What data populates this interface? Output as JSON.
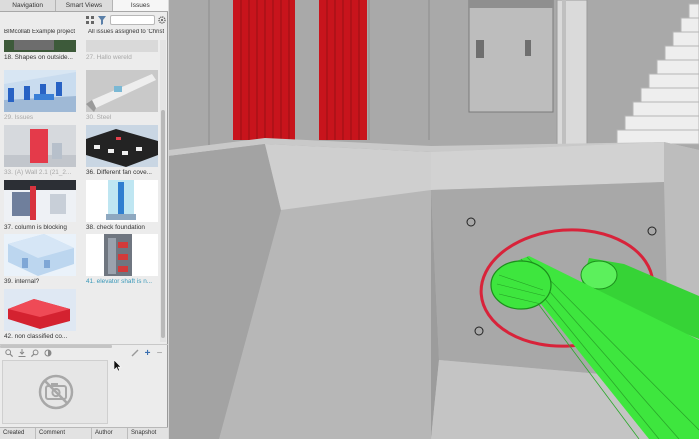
{
  "tabs": [
    {
      "label": "Navigation",
      "active": false
    },
    {
      "label": "Smart Views",
      "active": false
    },
    {
      "label": "Issues",
      "active": true
    }
  ],
  "filter": {
    "search_value": ""
  },
  "project": {
    "left": "BIMcollab Example project",
    "right": "All issues assigned to 'Christi..."
  },
  "issues": [
    {
      "label": "18. Shapes on outside...",
      "style": "normal"
    },
    {
      "label": "27. Hallo wereld",
      "style": "dim"
    },
    {
      "label": "29. Issues",
      "style": "dim"
    },
    {
      "label": "30. Steel",
      "style": "dim"
    },
    {
      "label": "33. (A) Wall 2.1 (21_2...",
      "style": "dim"
    },
    {
      "label": "36. Different fan cove...",
      "style": "normal"
    },
    {
      "label": "37. column is blocking",
      "style": "normal"
    },
    {
      "label": "38. check foundation",
      "style": "normal"
    },
    {
      "label": "39. internal?",
      "style": "normal"
    },
    {
      "label": "41. elevator shaft is n...",
      "style": "link"
    },
    {
      "label": "42. non classified co...",
      "style": "normal"
    }
  ],
  "columns": [
    "Created",
    "Comment",
    "Author",
    "Snapshot"
  ],
  "colors": {
    "accent": "#3a98b8",
    "clash_pipe": "#3ee63e",
    "highlight_ring": "#d8233a",
    "red_column": "#c8141c"
  }
}
